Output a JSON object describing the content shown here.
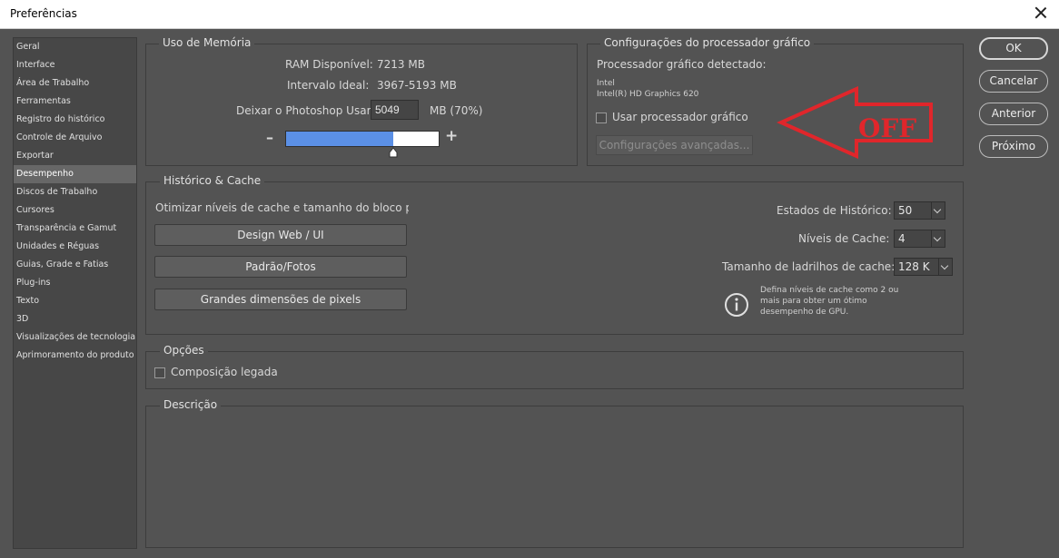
{
  "window": {
    "title": "Preferências"
  },
  "sidebar": {
    "items": [
      {
        "label": "Geral"
      },
      {
        "label": "Interface"
      },
      {
        "label": "Área de Trabalho"
      },
      {
        "label": "Ferramentas"
      },
      {
        "label": "Registro do histórico"
      },
      {
        "label": "Controle de Arquivo"
      },
      {
        "label": "Exportar"
      },
      {
        "label": "Desempenho",
        "selected": true
      },
      {
        "label": "Discos de Trabalho"
      },
      {
        "label": "Cursores"
      },
      {
        "label": "Transparência e Gamut"
      },
      {
        "label": "Unidades e Réguas"
      },
      {
        "label": "Guias, Grade e Fatias"
      },
      {
        "label": "Plug-ins"
      },
      {
        "label": "Texto"
      },
      {
        "label": "3D"
      },
      {
        "label": "Visualizações de tecnologia"
      },
      {
        "label": "Aprimoramento do produto"
      }
    ]
  },
  "memory": {
    "title": "Uso de Memória",
    "ram_label": "RAM Disponível:",
    "ram_value": "7213 MB",
    "ideal_label": "Intervalo Ideal:",
    "ideal_value": "3967-5193 MB",
    "let_label": "Deixar o Photoshop Usar:",
    "let_value": "5049",
    "let_unit": "MB (70%)",
    "slider_fraction": 0.7,
    "minus": "–",
    "plus": "+"
  },
  "gpu": {
    "title": "Configurações do processador gráfico",
    "detected_label": "Processador gráfico detectado:",
    "vendor": "Intel",
    "model": "Intel(R) HD Graphics 620",
    "use_label": "Usar processador gráfico",
    "use_checked": false,
    "advanced_label": "Configurações avançadas...",
    "annotation_text": "OFF",
    "annotation_color": "#e0262b"
  },
  "cache": {
    "title": "Histórico & Cache",
    "optimize_label": "Otimizar níveis de cache e tamanho do bloco para:",
    "buttons": [
      "Design Web / UI",
      "Padrão/Fotos",
      "Grandes dimensões de pixels"
    ],
    "history_label": "Estados de Histórico:",
    "history_value": "50",
    "levels_label": "Níveis de Cache:",
    "levels_value": "4",
    "tile_label": "Tamanho de ladrilhos de cache:",
    "tile_value": "128 K",
    "info_text": "Defina níveis de cache como 2 ou mais para obter um ótimo desempenho de GPU."
  },
  "options": {
    "title": "Opções",
    "legacy_label": "Composição legada",
    "legacy_checked": false
  },
  "description": {
    "title": "Descrição"
  },
  "actions": {
    "ok": "OK",
    "cancel": "Cancelar",
    "prev": "Anterior",
    "next": "Próximo"
  },
  "colors": {
    "slider_fill": "#5b90e6",
    "accent": "#e0262b"
  }
}
